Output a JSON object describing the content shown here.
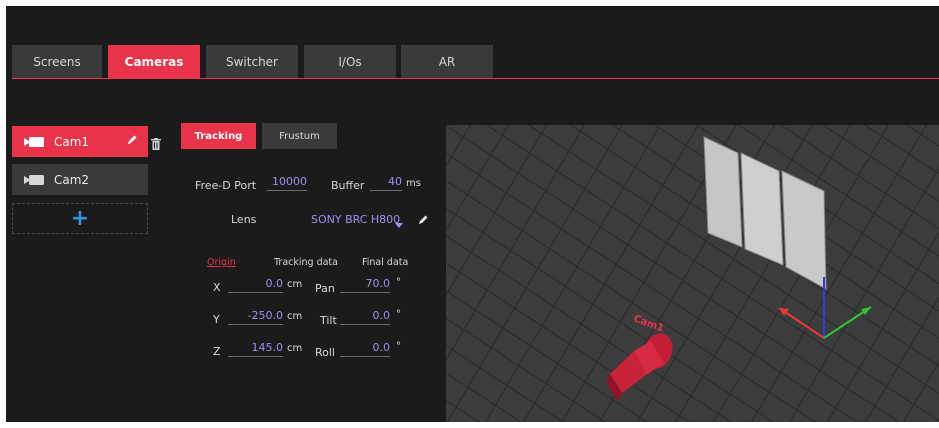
{
  "tabs": [
    {
      "label": "Screens",
      "active": false
    },
    {
      "label": "Cameras",
      "active": true
    },
    {
      "label": "Switcher",
      "active": false
    },
    {
      "label": "I/Os",
      "active": false
    },
    {
      "label": "AR",
      "active": false
    }
  ],
  "cameras": [
    {
      "label": "Cam1",
      "active": true
    },
    {
      "label": "Cam2",
      "active": false
    }
  ],
  "add_camera_label": "+",
  "subtabs": [
    {
      "label": "Tracking",
      "active": true
    },
    {
      "label": "Frustum",
      "active": false
    }
  ],
  "tracking": {
    "freed_port_label": "Free-D Port",
    "freed_port_value": "10000",
    "buffer_label": "Buffer",
    "buffer_value": "40",
    "buffer_unit": "ms",
    "lens_label": "Lens",
    "lens_value": "SONY BRC H800",
    "origin_header": "Origin",
    "tracking_header": "Tracking data",
    "final_header": "Final data",
    "rows": [
      {
        "axis": "X",
        "value": "0.0",
        "unit": "cm",
        "rot_label": "Pan",
        "rot_value": "70.0",
        "rot_unit": "°"
      },
      {
        "axis": "Y",
        "value": "-250.0",
        "unit": "cm",
        "rot_label": "Tilt",
        "rot_value": "0.0",
        "rot_unit": "°"
      },
      {
        "axis": "Z",
        "value": "145.0",
        "unit": "cm",
        "rot_label": "Roll",
        "rot_value": "0.0",
        "rot_unit": "°"
      }
    ]
  },
  "viewport": {
    "camera_label": "Cam1",
    "colors": {
      "accent": "#e8334a",
      "axis_x": "#e53935",
      "axis_y": "#2fc43a",
      "axis_z": "#2a3de8",
      "panel": "#c8c8c8",
      "bg": "#3c3c3c"
    }
  },
  "colors": {
    "accent": "#e8334a",
    "value_text": "#9d8ff0",
    "plus": "#2f96e0"
  }
}
